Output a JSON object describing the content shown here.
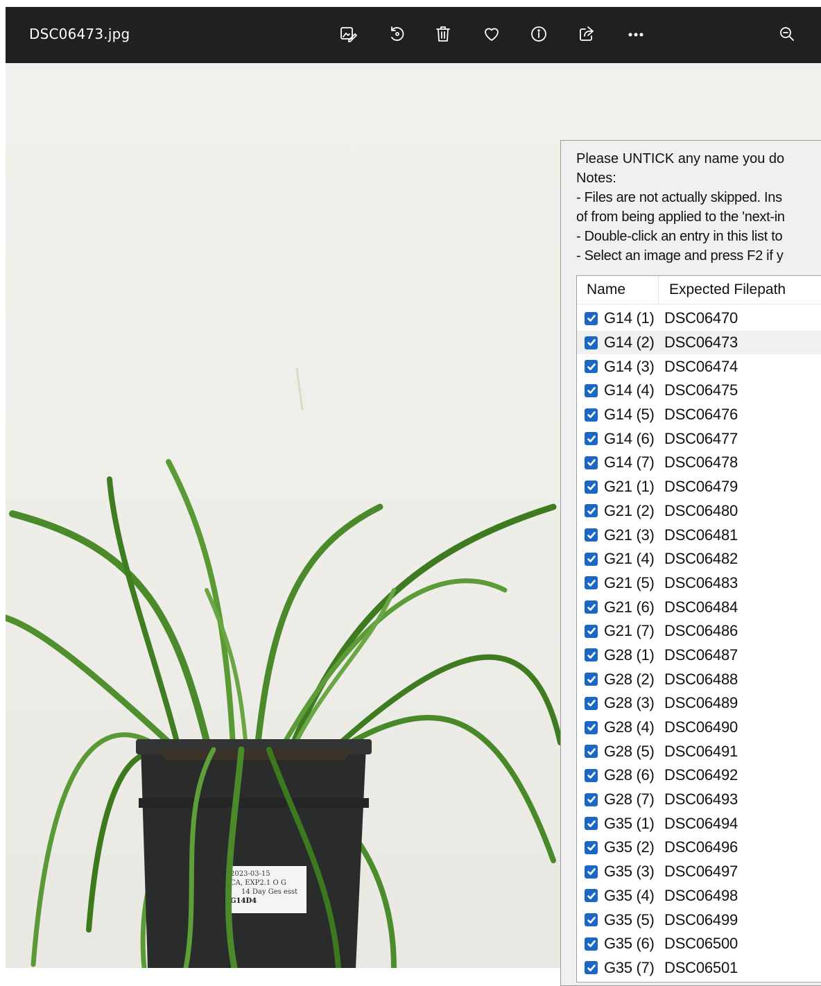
{
  "titlebar": {
    "filename": "DSC06473.jpg",
    "toolbar_icons": [
      "edit-image-icon",
      "rotate-icon",
      "delete-icon",
      "favorite-heart-icon",
      "info-icon",
      "share-icon",
      "more-options-icon",
      "zoom-out-icon"
    ]
  },
  "photo": {
    "label_lines": [
      "2023-03-15",
      "CA, EXP2.1 O  G",
      "14 Day Ges  esst",
      "G14D4"
    ]
  },
  "dialog": {
    "notes": [
      "Please UNTICK any name you do",
      "Notes:",
      " - Files are not actually skipped. Ins",
      "of from being applied to the 'next-in",
      " - Double-click an entry in this list to",
      " - Select an image and press F2 if y"
    ],
    "list": {
      "columns": [
        "Name",
        "Expected Filepath"
      ],
      "selected_index": 1,
      "rows": [
        {
          "name": "G14 (1)",
          "path": "DSC06470"
        },
        {
          "name": "G14 (2)",
          "path": "DSC06473"
        },
        {
          "name": "G14 (3)",
          "path": "DSC06474"
        },
        {
          "name": "G14 (4)",
          "path": "DSC06475"
        },
        {
          "name": "G14 (5)",
          "path": "DSC06476"
        },
        {
          "name": "G14 (6)",
          "path": "DSC06477"
        },
        {
          "name": "G14 (7)",
          "path": "DSC06478"
        },
        {
          "name": "G21 (1)",
          "path": "DSC06479"
        },
        {
          "name": "G21 (2)",
          "path": "DSC06480"
        },
        {
          "name": "G21 (3)",
          "path": "DSC06481"
        },
        {
          "name": "G21 (4)",
          "path": "DSC06482"
        },
        {
          "name": "G21 (5)",
          "path": "DSC06483"
        },
        {
          "name": "G21 (6)",
          "path": "DSC06484"
        },
        {
          "name": "G21 (7)",
          "path": "DSC06486"
        },
        {
          "name": "G28 (1)",
          "path": "DSC06487"
        },
        {
          "name": "G28 (2)",
          "path": "DSC06488"
        },
        {
          "name": "G28 (3)",
          "path": "DSC06489"
        },
        {
          "name": "G28 (4)",
          "path": "DSC06490"
        },
        {
          "name": "G28 (5)",
          "path": "DSC06491"
        },
        {
          "name": "G28 (6)",
          "path": "DSC06492"
        },
        {
          "name": "G28 (7)",
          "path": "DSC06493"
        },
        {
          "name": "G35 (1)",
          "path": "DSC06494"
        },
        {
          "name": "G35 (2)",
          "path": "DSC06496"
        },
        {
          "name": "G35 (3)",
          "path": "DSC06497"
        },
        {
          "name": "G35 (4)",
          "path": "DSC06498"
        },
        {
          "name": "G35 (5)",
          "path": "DSC06499"
        },
        {
          "name": "G35 (6)",
          "path": "DSC06500"
        },
        {
          "name": "G35 (7)",
          "path": "DSC06501"
        }
      ]
    }
  }
}
